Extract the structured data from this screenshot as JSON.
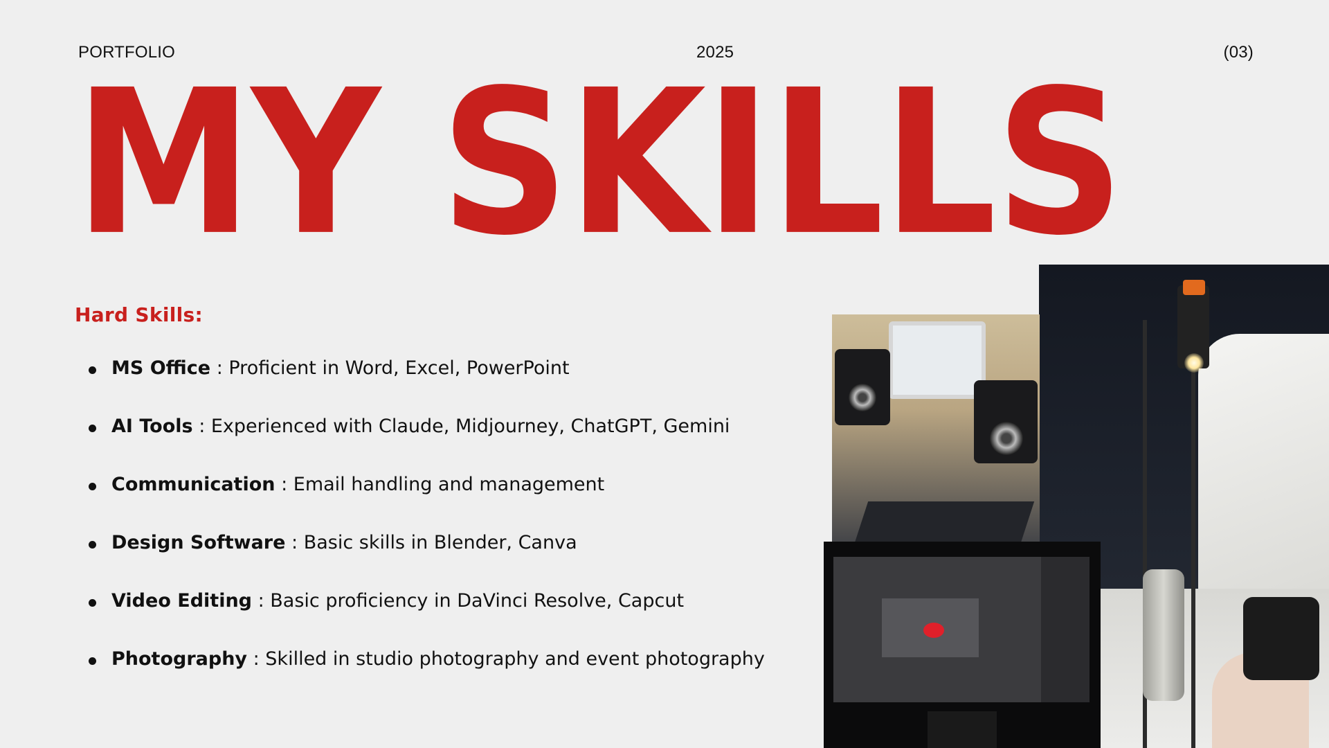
{
  "header": {
    "left": "PORTFOLIO",
    "center": "2025",
    "right": "(03)"
  },
  "title": "MY SKILLS",
  "section_label": "Hard Skills:",
  "skills": [
    {
      "name": "MS Office",
      "detail": "Proficient in Word, Excel, PowerPoint"
    },
    {
      "name": "AI Tools",
      "detail": "Experienced with Claude, Midjourney, ChatGPT, Gemini"
    },
    {
      "name": "Communication",
      "detail": "Email handling and management"
    },
    {
      "name": "Design Software",
      "detail": "Basic skills in Blender, Canva"
    },
    {
      "name": "Video Editing",
      "detail": "Basic proficiency in DaVinci Resolve, Capcut"
    },
    {
      "name": "Photography",
      "detail": "Skilled in studio photography and event photography"
    }
  ],
  "separator": " : ",
  "colors": {
    "accent": "#c8201d",
    "background": "#efefef",
    "text": "#111111"
  },
  "photos": [
    {
      "subject": "studio photography setup with light stand and camera"
    },
    {
      "subject": "desk with monitor, microphone and speakers"
    },
    {
      "subject": "monitor showing 3D software"
    }
  ]
}
